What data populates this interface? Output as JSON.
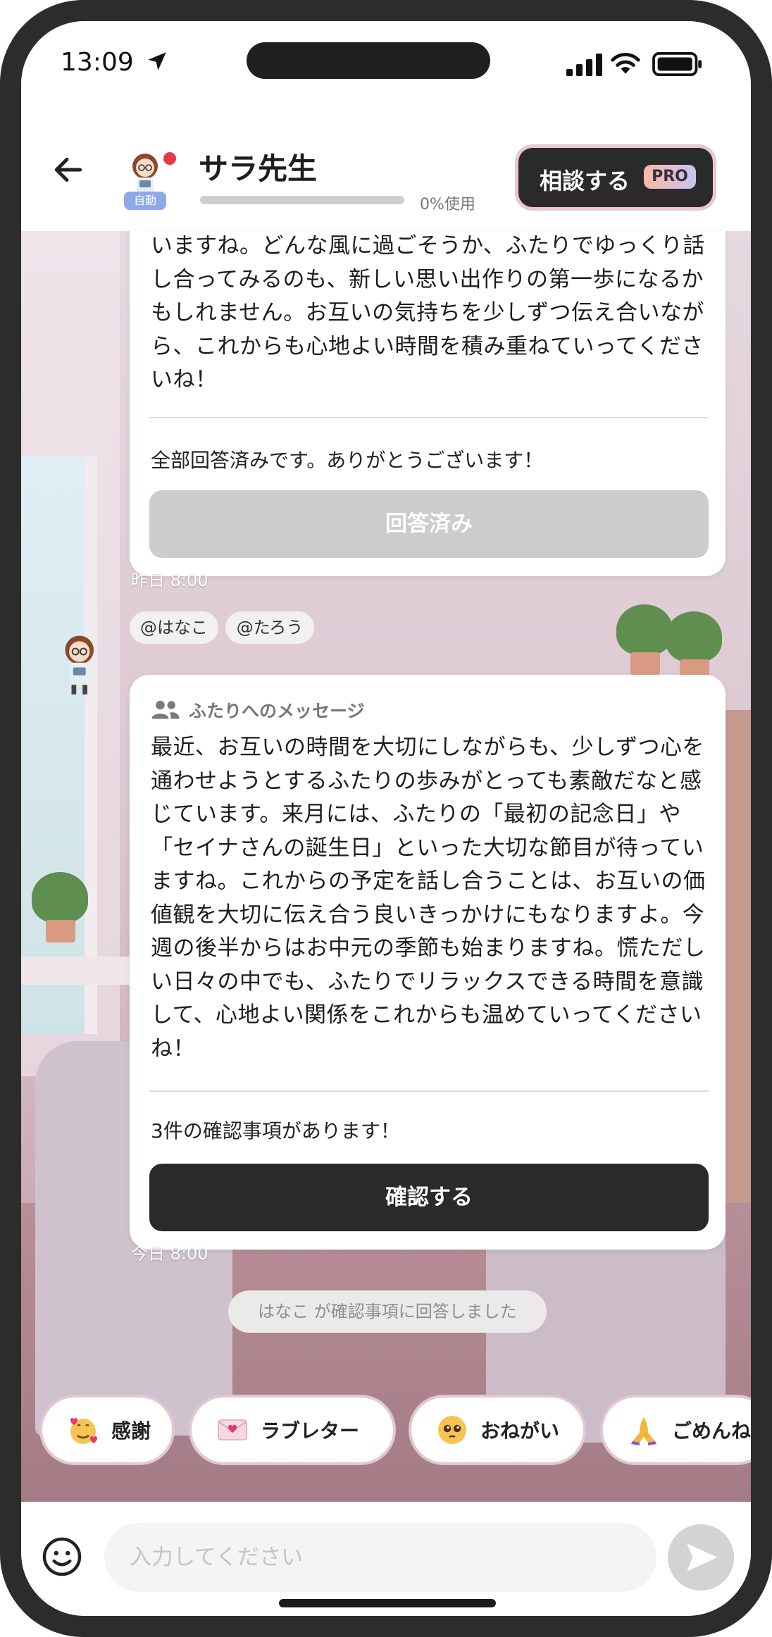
{
  "status": {
    "time": "13:09"
  },
  "header": {
    "title": "サラ先生",
    "auto_badge": "自動",
    "usage_percent": 0,
    "usage_text": "0%使用",
    "consult_label": "相談する",
    "pro_badge": "PRO"
  },
  "card1": {
    "text": "いますね。どんな風に過ごそうか、ふたりでゆっくり話し合ってみるのも、新しい思い出作りの第一歩になるかもしれません。お互いの気持ちを少しずつ伝え合いながら、これからも心地よい時間を積み重ねていってくださいね！",
    "note": "全部回答済みです。ありがとうございます！",
    "button": "回答済み"
  },
  "timestamps": {
    "yesterday": "昨日 8:00",
    "today": "今日 8:00"
  },
  "mentions": [
    "@はなこ",
    "@たろう"
  ],
  "card2": {
    "header": "ふたりへのメッセージ",
    "text": "最近、お互いの時間を大切にしながらも、少しずつ心を通わせようとするふたりの歩みがとっても素敵だなと感じています。来月には、ふたりの「最初の記念日」や「セイナさんの誕生日」といった大切な節目が待っていますね。これからの予定を話し合うことは、お互いの価値観を大切に伝え合う良いきっかけにもなりますよ。今週の後半からはお中元の季節も始まりますね。慌ただしい日々の中でも、ふたりでリラックスできる時間を意識して、心地よい関係をこれからも温めていってくださいね！",
    "note": "3件の確認事項があります！",
    "button": "確認する"
  },
  "system_message": "はなこ が確認事項に回答しました",
  "chips": [
    {
      "label": "感謝",
      "icon": "hearts-face-icon"
    },
    {
      "label": "ラブレター",
      "icon": "love-letter-icon"
    },
    {
      "label": "おねがい",
      "icon": "pleading-face-icon"
    },
    {
      "label": "ごめんね",
      "icon": "folded-hands-icon"
    }
  ],
  "input": {
    "placeholder": "入力してください"
  }
}
